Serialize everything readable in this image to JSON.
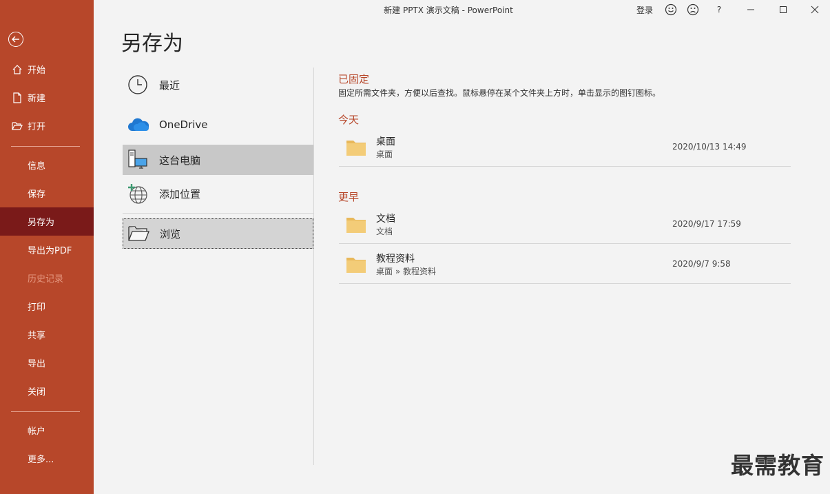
{
  "window": {
    "title": "新建 PPTX 演示文稿  -  PowerPoint",
    "login": "登录",
    "help": "?"
  },
  "nav": {
    "top_items": [
      {
        "label": "开始",
        "icon": "home-icon"
      },
      {
        "label": "新建",
        "icon": "new-file-icon"
      },
      {
        "label": "打开",
        "icon": "folder-open-icon"
      }
    ],
    "mid_items": [
      "信息",
      "保存",
      "另存为",
      "导出为PDF",
      "历史记录",
      "打印",
      "共享",
      "导出",
      "关闭"
    ],
    "bottom_items": [
      "帐户",
      "更多..."
    ],
    "active": "另存为",
    "disabled": "历史记录"
  },
  "page": {
    "title": "另存为"
  },
  "locations": [
    {
      "label": "最近",
      "icon": "clock-icon"
    },
    {
      "label": "OneDrive",
      "icon": "onedrive-cloud-icon"
    },
    {
      "label": "这台电脑",
      "icon": "this-pc-icon"
    },
    {
      "label": "添加位置",
      "icon": "add-place-globe-icon"
    },
    {
      "label": "浏览",
      "icon": "browse-folder-icon"
    }
  ],
  "pinned": {
    "title": "已固定",
    "description": "固定所需文件夹，方便以后查找。鼠标悬停在某个文件夹上方时，单击显示的图钉图标。"
  },
  "today": {
    "title": "今天",
    "folders": [
      {
        "name": "桌面",
        "path": "桌面",
        "date": "2020/10/13 14:49"
      }
    ]
  },
  "earlier": {
    "title": "更早",
    "folders": [
      {
        "name": "文档",
        "path": "文档",
        "date": "2020/9/17 17:59"
      },
      {
        "name": "教程资料",
        "path": "桌面 » 教程资料",
        "date": "2020/9/7 9:58"
      }
    ]
  },
  "watermark": "最需教育",
  "colors": {
    "accent": "#b7472a",
    "nav_active": "#7a1a19",
    "folder": "#f0c674"
  }
}
